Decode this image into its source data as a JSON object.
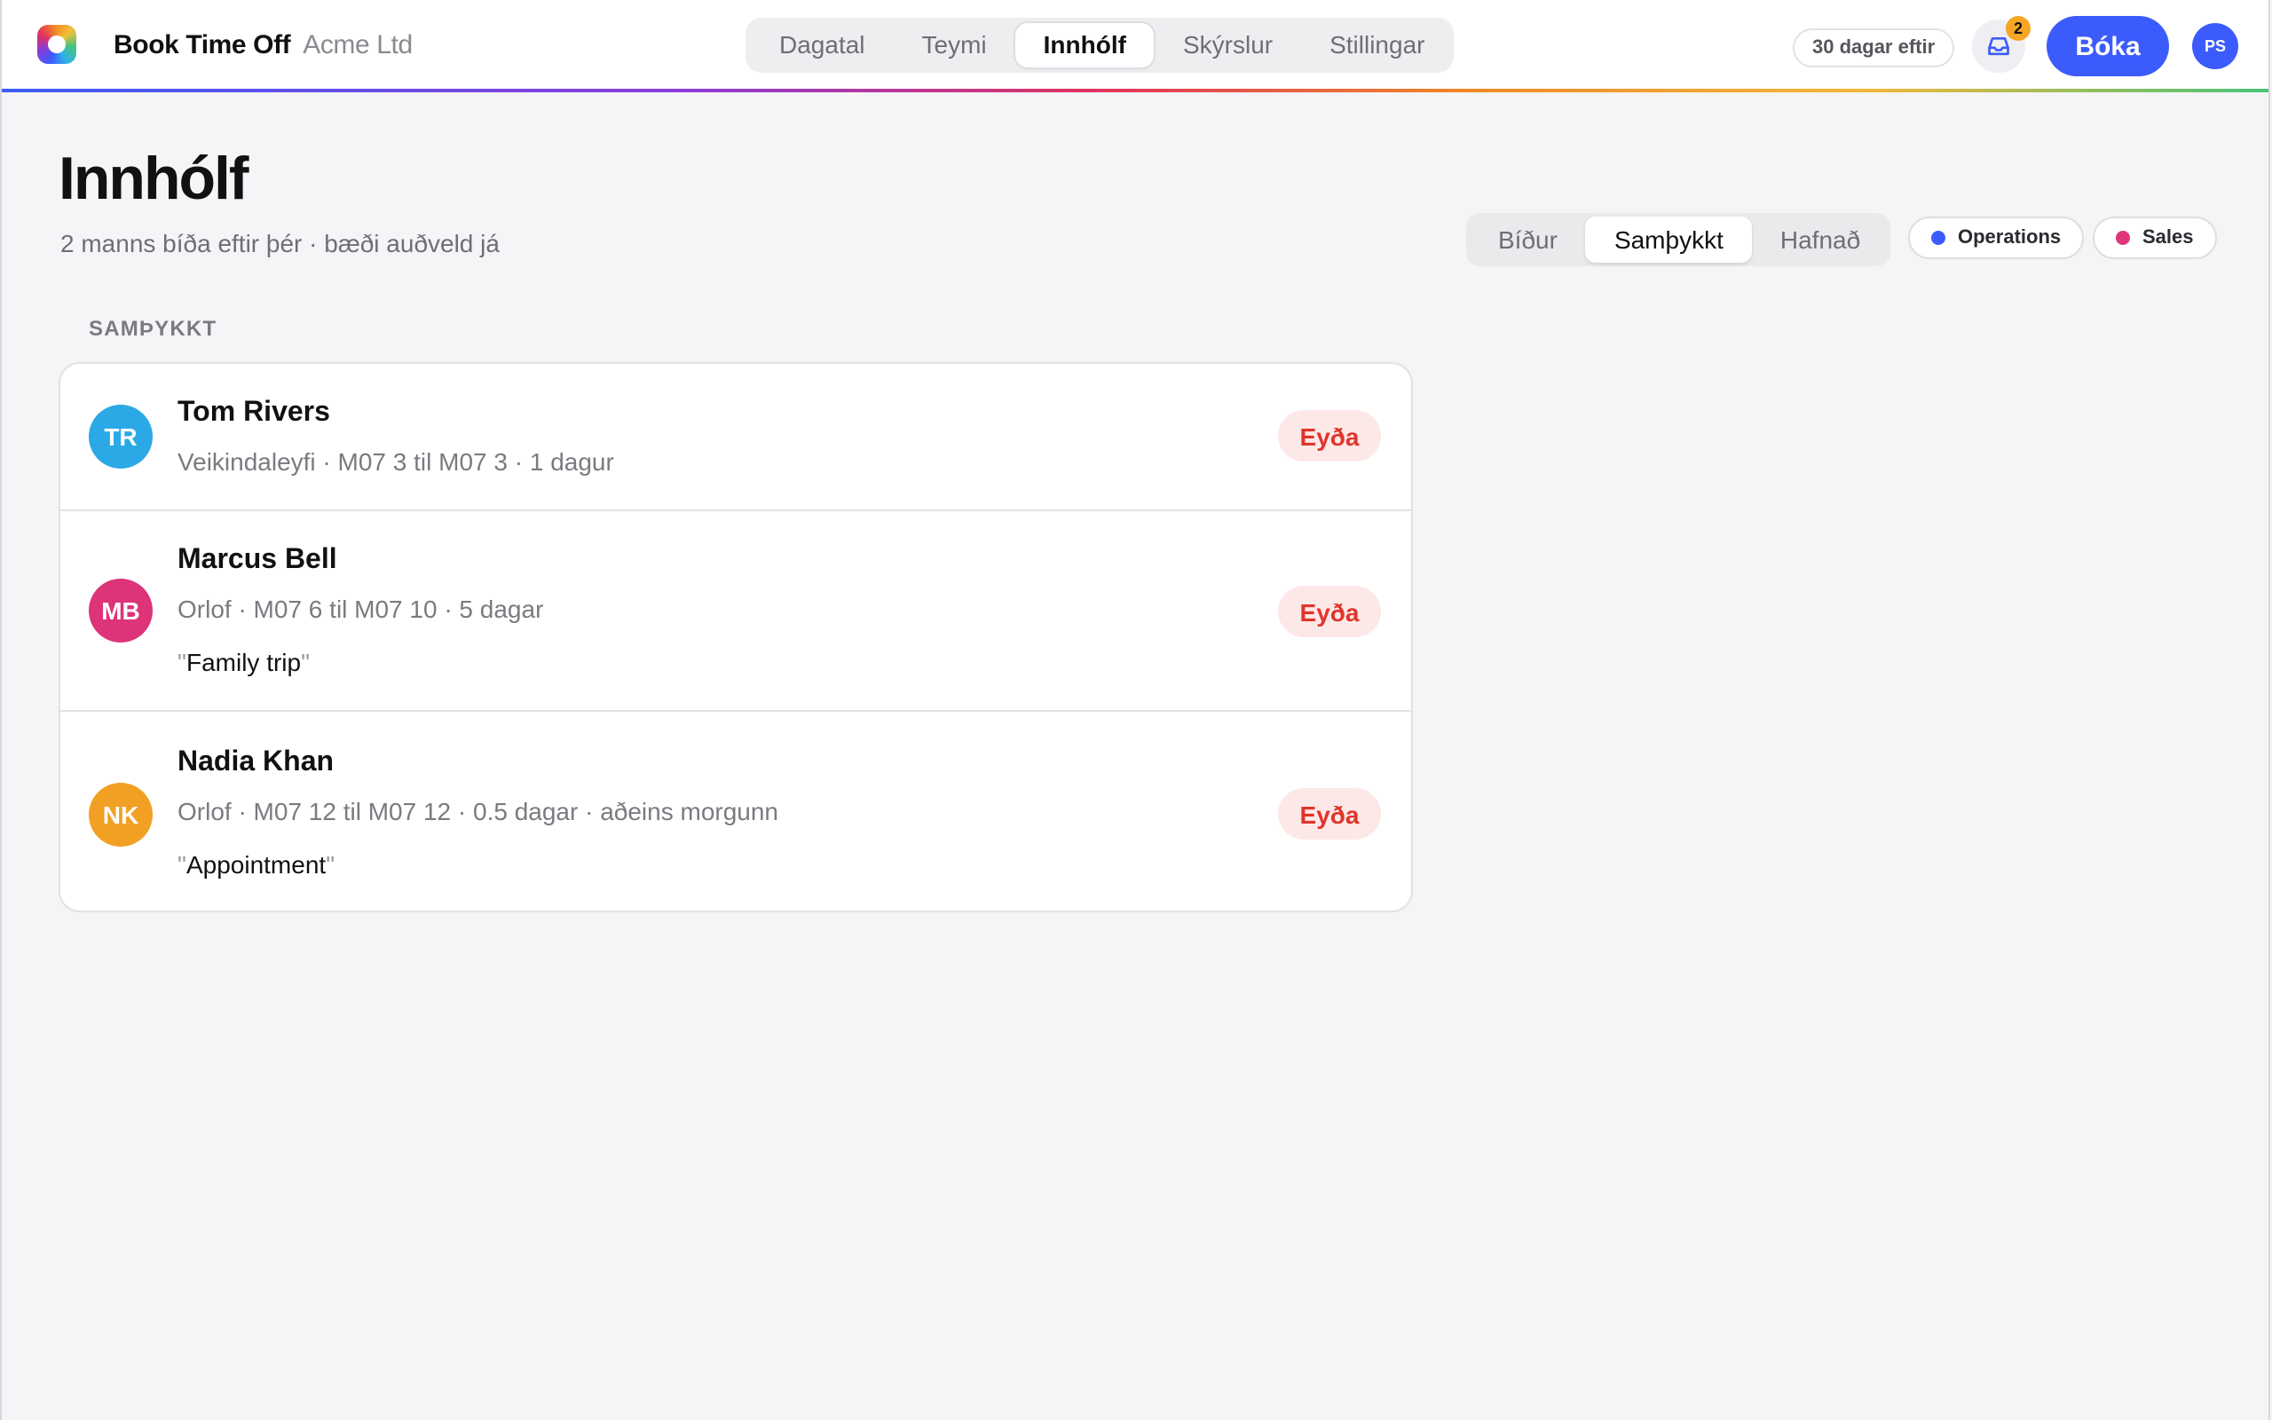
{
  "app": {
    "name": "Book Time Off",
    "org": "Acme Ltd"
  },
  "nav": {
    "items": [
      {
        "label": "Dagatal"
      },
      {
        "label": "Teymi"
      },
      {
        "label": "Innhólf",
        "active": true
      },
      {
        "label": "Skýrslur"
      },
      {
        "label": "Stillingar"
      }
    ]
  },
  "header_right": {
    "days_left": "30 dagar eftir",
    "inbox_count": "2",
    "book_label": "Bóka",
    "user_initials": "PS"
  },
  "page": {
    "title": "Innhólf",
    "subtitle": "2 manns bíða eftir þér · bæði auðveld já"
  },
  "status_tabs": [
    {
      "label": "Bíður"
    },
    {
      "label": "Samþykkt",
      "active": true
    },
    {
      "label": "Hafnað"
    }
  ],
  "team_filters": [
    {
      "label": "Operations",
      "color": "#3b5bfd"
    },
    {
      "label": "Sales",
      "color": "#e0357a"
    }
  ],
  "section": {
    "label": "SAMÞYKKT"
  },
  "requests": [
    {
      "initials": "TR",
      "avatar_color": "#2ba8e6",
      "name": "Tom Rivers",
      "meta": "Veikindaleyfi · M07 3 til M07 3 · 1 dagur",
      "note": null,
      "action": "Eyða"
    },
    {
      "initials": "MB",
      "avatar_color": "#dc3379",
      "name": "Marcus Bell",
      "meta": "Orlof · M07 6 til M07 10 · 5 dagar",
      "note": "Family trip",
      "action": "Eyða"
    },
    {
      "initials": "NK",
      "avatar_color": "#f2a024",
      "name": "Nadia Khan",
      "meta": "Orlof · M07 12 til M07 12 · 0.5 dagar · aðeins morgunn",
      "note": "Appointment",
      "action": "Eyða"
    }
  ]
}
